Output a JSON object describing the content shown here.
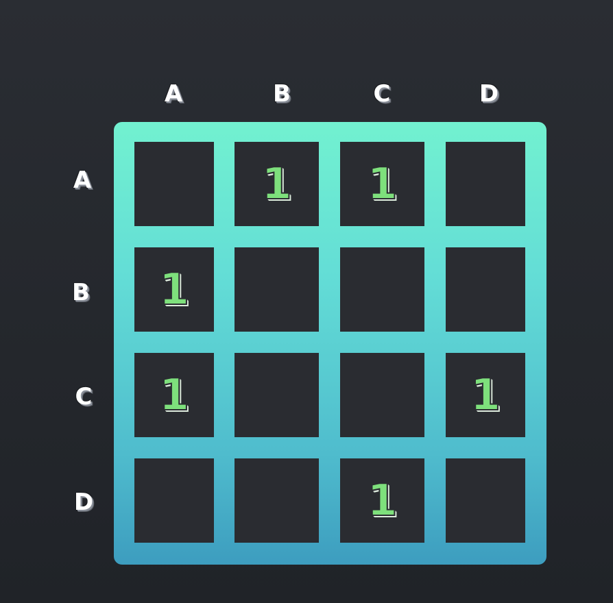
{
  "column_labels": [
    "A",
    "B",
    "C",
    "D"
  ],
  "row_labels": [
    "A",
    "B",
    "C",
    "D"
  ],
  "matrix": [
    [
      "",
      "1",
      "1",
      ""
    ],
    [
      "1",
      "",
      "",
      ""
    ],
    [
      "1",
      "",
      "",
      "1"
    ],
    [
      "",
      "",
      "1",
      ""
    ]
  ],
  "colors": {
    "background": "#262930",
    "grid_top": "#72f1d0",
    "grid_bottom": "#3d9dbf",
    "cell": "#2a2c31",
    "value": "#7ee07c",
    "label": "#ffffff"
  }
}
